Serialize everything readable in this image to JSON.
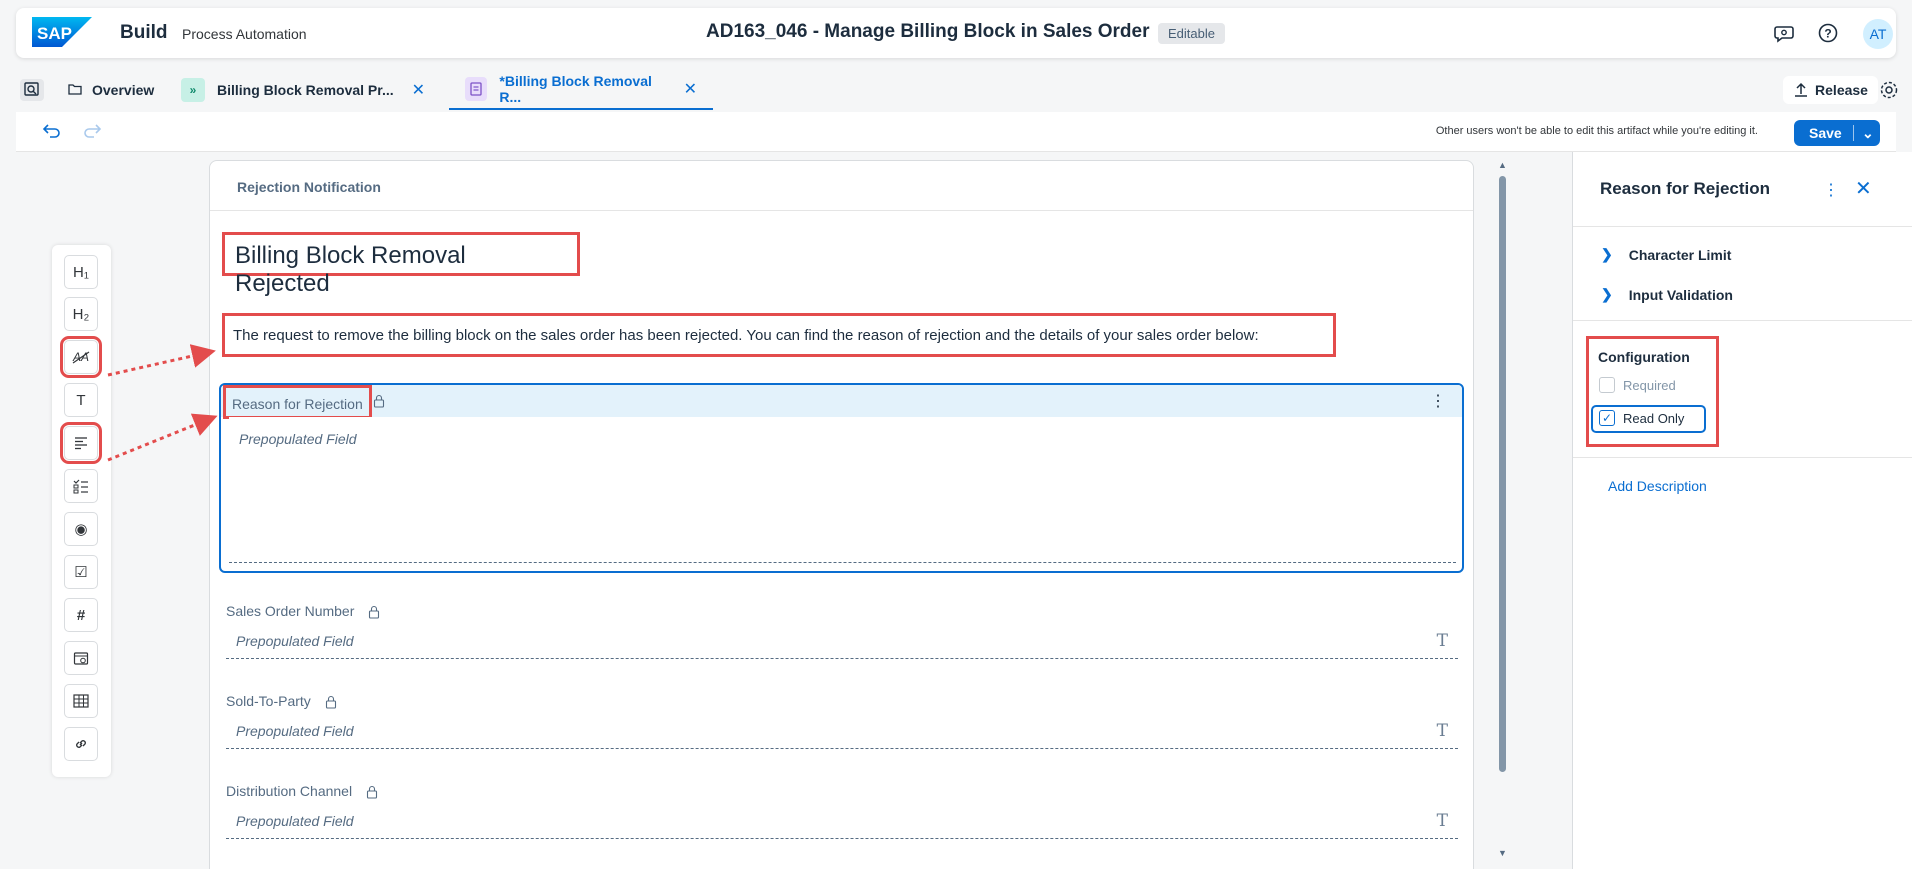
{
  "shell": {
    "logo_text": "SAP",
    "product": "Build",
    "subproduct": "Process Automation",
    "title": "AD163_046 - Manage Billing Block in Sales Order",
    "status_badge": "Editable",
    "avatar_initials": "AT"
  },
  "tabs": [
    {
      "label": "Overview",
      "icon": "folder-icon"
    },
    {
      "label": "Billing Block Removal Pr...",
      "icon": "process-icon"
    },
    {
      "label": "*Billing Block Removal R...",
      "icon": "form-icon",
      "active": true
    }
  ],
  "release_label": "Release",
  "toolbar": {
    "note": "Other users won't be able to edit this artifact while you're editing it.",
    "save_label": "Save"
  },
  "palette": [
    {
      "name": "heading-1",
      "glyph": "H₁"
    },
    {
      "name": "heading-2",
      "glyph": "H₂"
    },
    {
      "name": "paragraph-text",
      "glyph": "A̸",
      "highlighted": true
    },
    {
      "name": "text-input",
      "glyph": "T"
    },
    {
      "name": "text-area",
      "glyph": "≡",
      "highlighted": true
    },
    {
      "name": "checklist",
      "glyph": "☷"
    },
    {
      "name": "radio",
      "glyph": "◉"
    },
    {
      "name": "checkbox",
      "glyph": "☑"
    },
    {
      "name": "number",
      "glyph": "#"
    },
    {
      "name": "date",
      "glyph": "▣"
    },
    {
      "name": "table",
      "glyph": "▦"
    },
    {
      "name": "link",
      "glyph": "⛓"
    }
  ],
  "form": {
    "header": "Rejection Notification",
    "heading": "Billing Block Removal Rejected",
    "paragraph": "The request to remove the billing block on the sales order has been rejected. You can find the reason of rejection and the details of your sales order below:",
    "selected_field": {
      "label": "Reason for Rejection",
      "placeholder": "Prepopulated Field"
    },
    "fields": [
      {
        "label": "Sales Order Number",
        "placeholder": "Prepopulated Field"
      },
      {
        "label": "Sold-To-Party",
        "placeholder": "Prepopulated Field"
      },
      {
        "label": "Distribution Channel",
        "placeholder": "Prepopulated Field"
      }
    ]
  },
  "panel": {
    "title": "Reason for Rejection",
    "sections": [
      "Character Limit",
      "Input Validation"
    ],
    "config_title": "Configuration",
    "required_label": "Required",
    "readonly_label": "Read Only",
    "required_checked": false,
    "readonly_checked": true,
    "add_description": "Add Description"
  },
  "colors": {
    "accent": "#0a6ed1",
    "highlight": "#e34c4c",
    "selected_bg": "#e3f2fb"
  }
}
